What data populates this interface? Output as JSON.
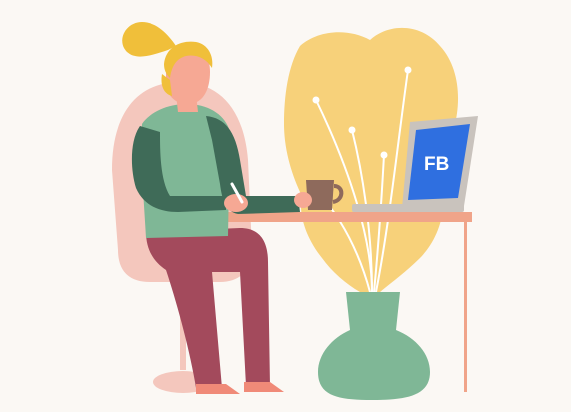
{
  "scene": {
    "laptop_screen_text": "FB"
  },
  "colors": {
    "background": "#fbf8f4",
    "plant_leaf": "#f7d17a",
    "plant_vein": "#ffffff",
    "vase": "#7fb796",
    "chair": "#f4c7bd",
    "desk": "#f0a489",
    "skin": "#f6a894",
    "hair": "#f0bf3a",
    "shirt": "#7fb796",
    "sleeve": "#3f6b58",
    "pants": "#a34a5c",
    "shoes": "#f08a78",
    "laptop_frame": "#c9c3bd",
    "laptop_screen": "#2f6fe0",
    "mug": "#8e6a5c"
  }
}
